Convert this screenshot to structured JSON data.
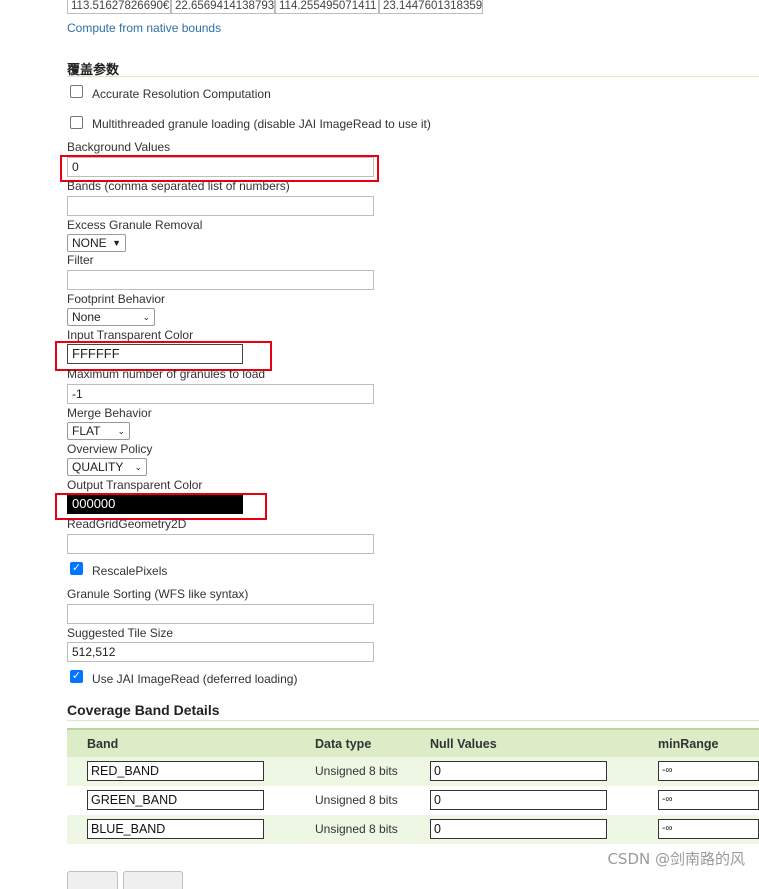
{
  "bbox_values": [
    "113.51627826690€",
    "22.6569414138793",
    "114.255495071411",
    "23.1447601318359"
  ],
  "compute_link": "Compute from native bounds",
  "section_title": "覆盖参数",
  "options": {
    "accurate_resolution": {
      "label": "Accurate Resolution Computation",
      "checked": false
    },
    "multithreaded": {
      "label": "Multithreaded granule loading (disable JAI ImageRead to use it)",
      "checked": false
    },
    "rescale_pixels": {
      "label": "RescalePixels",
      "checked": true
    },
    "use_jai": {
      "label": "Use JAI ImageRead (deferred loading)",
      "checked": true
    }
  },
  "fields": {
    "background_values": {
      "label": "Background Values",
      "value": "0"
    },
    "bands": {
      "label": "Bands (comma separated list of numbers)",
      "value": ""
    },
    "excess_granule_removal": {
      "label": "Excess Granule Removal",
      "value": "NONE"
    },
    "filter": {
      "label": "Filter",
      "value": ""
    },
    "footprint_behavior": {
      "label": "Footprint Behavior",
      "value": "None"
    },
    "input_transparent_color": {
      "label": "Input Transparent Color",
      "value": "FFFFFF"
    },
    "max_granules": {
      "label": "Maximum number of granules to load",
      "value": "-1"
    },
    "merge_behavior": {
      "label": "Merge Behavior",
      "value": "FLAT"
    },
    "overview_policy": {
      "label": "Overview Policy",
      "value": "QUALITY"
    },
    "output_transparent_color": {
      "label": "Output Transparent Color",
      "value": "000000"
    },
    "read_grid_geometry": {
      "label": "ReadGridGeometry2D",
      "value": ""
    },
    "granule_sorting": {
      "label": "Granule Sorting (WFS like syntax)",
      "value": ""
    },
    "suggested_tile_size": {
      "label": "Suggested Tile Size",
      "value": "512,512"
    }
  },
  "band_details": {
    "title": "Coverage Band Details",
    "headers": [
      "Band",
      "Data type",
      "Null Values",
      "minRange"
    ],
    "rows": [
      {
        "band": "RED_BAND",
        "data_type": "Unsigned 8 bits",
        "null_value": "0",
        "min_range": "-∞"
      },
      {
        "band": "GREEN_BAND",
        "data_type": "Unsigned 8 bits",
        "null_value": "0",
        "min_range": "-∞"
      },
      {
        "band": "BLUE_BAND",
        "data_type": "Unsigned 8 bits",
        "null_value": "0",
        "min_range": "-∞"
      }
    ]
  },
  "watermark": "CSDN @剑南路的风",
  "colors": {
    "highlight_red": "#e60012",
    "table_header": "#dcecc7",
    "link": "#2a6fa8",
    "checkbox": "#0075ff"
  }
}
